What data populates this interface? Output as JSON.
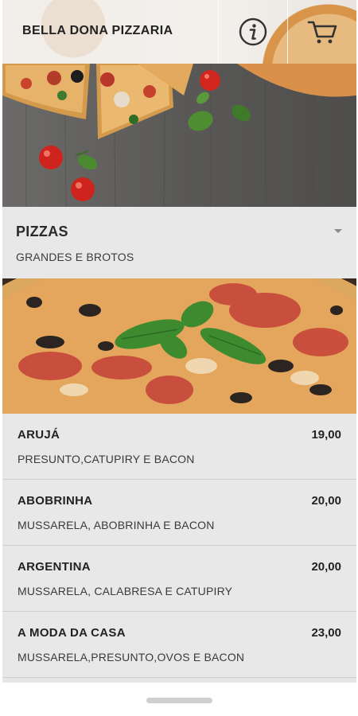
{
  "header": {
    "title": "BELLA DONA PIZZARIA",
    "info_icon": "info-circle-icon",
    "cart_icon": "shopping-cart-icon"
  },
  "category": {
    "title": "PIZZAS",
    "subtitle": "GRANDES E BROTOS",
    "toggle_icon": "caret-down-icon"
  },
  "items": [
    {
      "name": "ARUJÁ",
      "price": "19,00",
      "description": "PRESUNTO,CATUPIRY E BACON"
    },
    {
      "name": "ABOBRINHA",
      "price": "20,00",
      "description": "MUSSARELA, ABOBRINHA E BACON"
    },
    {
      "name": "ARGENTINA",
      "price": "20,00",
      "description": "MUSSARELA, CALABRESA E CATUPIRY"
    },
    {
      "name": "A MODA DA CASA",
      "price": "23,00",
      "description": "MUSSARELA,PRESUNTO,OVOS E BACON"
    }
  ],
  "colors": {
    "header_bg": "#f1eeea",
    "list_bg": "#e8e8e8",
    "text": "#222222",
    "wood": "#5f5e5c"
  }
}
